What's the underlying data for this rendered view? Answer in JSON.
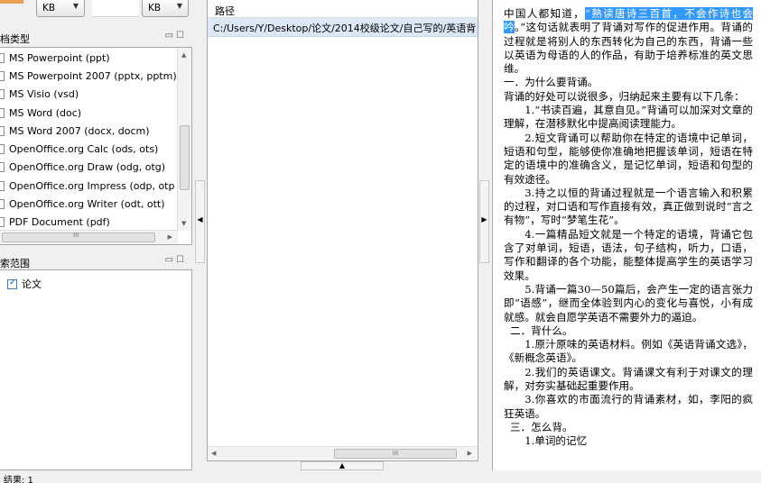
{
  "size_filter": {
    "unit_min": "KB",
    "unit_max": "KB"
  },
  "doc_types": {
    "title": "档类型",
    "items": [
      "MS Powerpoint (ppt)",
      "MS Powerpoint 2007 (pptx, pptm)",
      "MS Visio (vsd)",
      "MS Word (doc)",
      "MS Word 2007 (docx, docm)",
      "OpenOffice.org Calc (ods, ots)",
      "OpenOffice.org Draw (odg, otg)",
      "OpenOffice.org Impress (odp, otp",
      "OpenOffice.org Writer (odt, ott)",
      "PDF Document (pdf)"
    ],
    "hscroll_glyph": "III"
  },
  "scope": {
    "title": "索范围",
    "items": [
      {
        "label": "论文",
        "checked": true
      }
    ]
  },
  "results": {
    "column_header": "路径",
    "rows": [
      "C:/Users/Y/Desktop/论文/2014校级论文/自己写的/英语背"
    ],
    "hscroll_glyph": "III"
  },
  "preview": {
    "paragraphs": [
      {
        "before": "中国人都知道，",
        "highlight": "“熟读唐诗三百首，不会作诗也会吟",
        "after": "。”这句话就表明了背诵对写作的促进作用。背诵的过程就是将别人的东西转化为自己的东西，背诵一些以英语为母语的人的作品，有助于培养标准的英文思维。",
        "indent": false
      },
      {
        "text": "一．为什么要背诵。",
        "indent": false
      },
      {
        "text": "背诵的好处可以说很多，归纳起来主要有以下几条：",
        "indent": false
      },
      {
        "text": "1.“书读百遍，其意自见。”背诵可以加深对文章的理解，在潜移默化中提高阅读理能力。",
        "indent": true
      },
      {
        "text": "2.短文背诵可以帮助你在特定的语境中记单词，短语和句型，能够使你准确地把握该单词，短语在特定的语境中的准确含义，是记忆单词，短语和句型的有效途径。",
        "indent": true
      },
      {
        "text": "3.持之以恒的背诵过程就是一个语言输入和积累的过程，对口语和写作直接有效，真正做到说时“言之有物”，写时“梦笔生花”。",
        "indent": true
      },
      {
        "text": "4.一篇精品短文就是一个特定的语境，背诵它包含了对单词，短语，语法，句子结构，听力，口语，写作和翻译的各个功能，能整体提高学生的英语学习效果。",
        "indent": true
      },
      {
        "text": "5.背诵一篇30—50篇后，会产生一定的语言张力即“语感”，继而全体验到内心的变化与喜悦，小有成就感。就会自愿学英语不需要外力的逼迫。",
        "indent": true
      },
      {
        "text": "二．背什么。",
        "indent": false,
        "pad": true
      },
      {
        "text": "1.原汁原味的英语材料。例如《英语背诵文选》，《新概念英语》。",
        "indent": true
      },
      {
        "text": "2.我们的英语课文。背诵课文有利于对课文的理解，对夯实基础起重要作用。",
        "indent": true
      },
      {
        "text": "3.你喜欢的市面流行的背诵素材，如，李阳的疯狂英语。",
        "indent": true
      },
      {
        "text": "三．怎么背。",
        "indent": false,
        "pad": true
      },
      {
        "text": "1.单词的记忆",
        "indent": true
      }
    ]
  },
  "status": {
    "text": "结果: 1"
  }
}
